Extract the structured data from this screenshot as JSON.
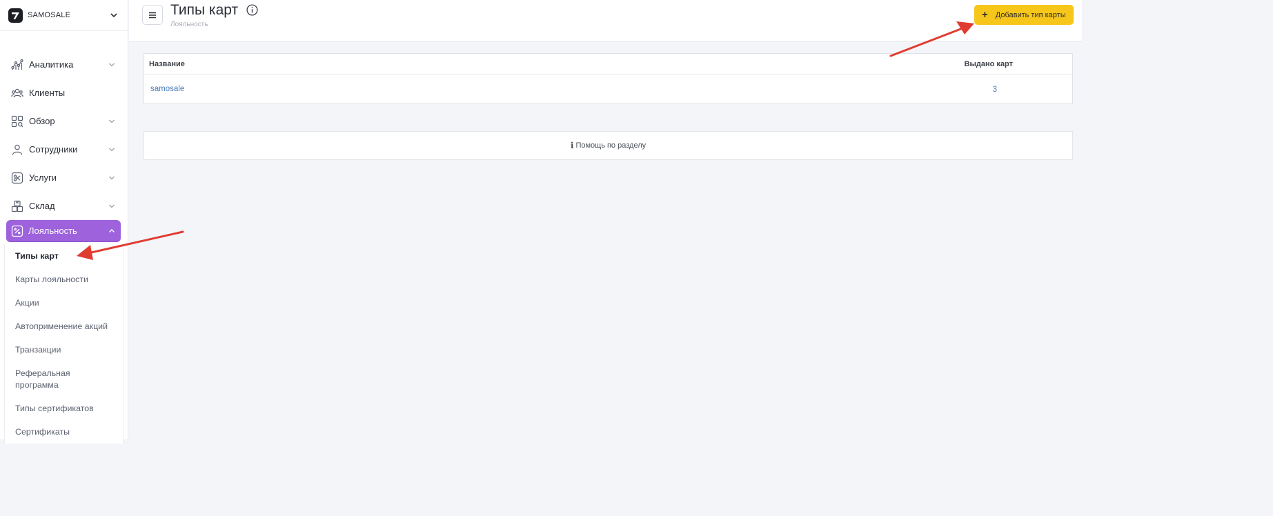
{
  "brand": {
    "name": "SAMOSALE"
  },
  "nav": [
    {
      "key": "analytics",
      "label": "Аналитика",
      "icon": "chart-icon",
      "chevron": true
    },
    {
      "key": "clients",
      "label": "Клиенты",
      "icon": "users-icon",
      "chevron": false
    },
    {
      "key": "overview",
      "label": "Обзор",
      "icon": "grid-search-icon",
      "chevron": true
    },
    {
      "key": "staff",
      "label": "Сотрудники",
      "icon": "person-icon",
      "chevron": true
    },
    {
      "key": "services",
      "label": "Услуги",
      "icon": "scissors-icon",
      "chevron": true
    },
    {
      "key": "warehouse",
      "label": "Склад",
      "icon": "boxes-icon",
      "chevron": true
    },
    {
      "key": "loyalty",
      "label": "Лояльность",
      "icon": "percent-icon",
      "chevron": true,
      "active": true
    }
  ],
  "submenu": [
    {
      "label": "Типы карт",
      "current": true
    },
    {
      "label": "Карты лояльности"
    },
    {
      "label": "Акции"
    },
    {
      "label": "Автоприменение акций"
    },
    {
      "label": "Транзакции"
    },
    {
      "label": "Реферальная программа"
    },
    {
      "label": "Типы сертификатов"
    },
    {
      "label": "Сертификаты"
    }
  ],
  "header": {
    "title": "Типы карт",
    "breadcrumb": "Лояльность",
    "add_button": "Добавить тип карты"
  },
  "table": {
    "columns": [
      "Название",
      "Выдано карт"
    ],
    "rows": [
      {
        "name": "samosale",
        "issued": "3"
      }
    ]
  },
  "help": {
    "label": "Помощь по разделу"
  },
  "colors": {
    "accent": "#9d62dc",
    "button": "#f6c61a",
    "link": "#4a7ab8",
    "annotation": "#e03c31"
  }
}
